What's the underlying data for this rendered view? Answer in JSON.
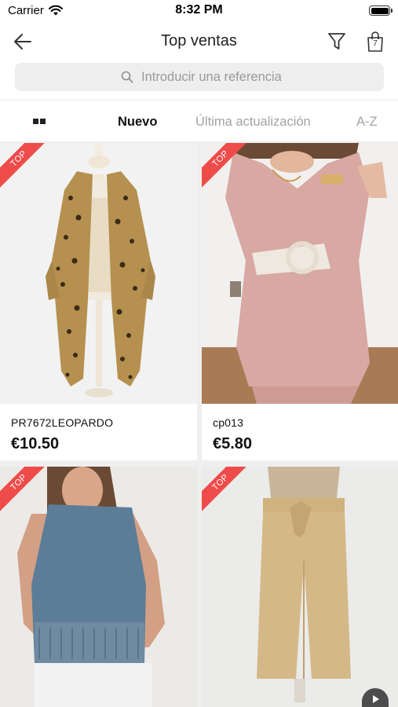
{
  "status_bar": {
    "carrier": "Carrier",
    "time": "8:32 PM"
  },
  "nav": {
    "title": "Top ventas",
    "cart_count": "7"
  },
  "search": {
    "placeholder": "Introducir una referencia"
  },
  "sort": {
    "new_label": "Nuevo",
    "updated_label": "Última actualización",
    "az_label": "A-Z"
  },
  "products": [
    {
      "badge": "TOP",
      "ref": "PR7672LEOPARDO",
      "price": "€10.50"
    },
    {
      "badge": "TOP",
      "ref": "cp013",
      "price": "€5.80"
    },
    {
      "badge": "TOP"
    },
    {
      "badge": "TOP"
    }
  ],
  "colors": {
    "badge_red": "#ef4b4b",
    "accent_text": "#111111",
    "muted_text": "#a3a3a3"
  }
}
